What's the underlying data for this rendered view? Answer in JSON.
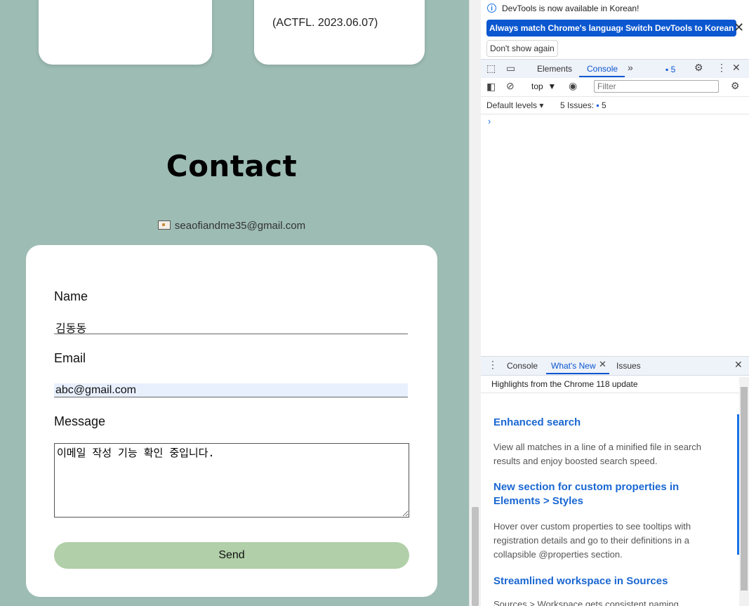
{
  "page": {
    "card_right_text": "(ACTFL. 2023.06.07)",
    "contact_title": "Contact",
    "contact_email": "seaofiandme35@gmail.com",
    "form": {
      "name_label": "Name",
      "name_value": "김동동",
      "email_label": "Email",
      "email_value": "abc@gmail.com",
      "message_label": "Message",
      "message_value": "이메일 작성 기능 확인 중입니다.",
      "send_label": "Send"
    }
  },
  "devtools": {
    "infobar": {
      "text": "DevTools is now available in Korean!",
      "match_language": "Always match Chrome's language",
      "switch_korean": "Switch DevTools to Korean",
      "dont_show": "Don't show again"
    },
    "tabs": {
      "elements": "Elements",
      "console": "Console",
      "issues_count": "5"
    },
    "console_toolbar": {
      "context": "top",
      "filter_placeholder": "Filter",
      "default_levels": "Default levels",
      "issues_label": "5 Issues:",
      "issues_count": "5"
    },
    "drawer": {
      "tab_console": "Console",
      "tab_whatsnew": "What's New",
      "tab_issues": "Issues",
      "highlights": "Highlights from the Chrome 118 update",
      "items": [
        {
          "title": "Enhanced search",
          "desc": "View all matches in a line of a minified file in search results and enjoy boosted search speed."
        },
        {
          "title": "New section for custom properties in Elements > Styles",
          "desc": "Hover over custom properties to see tooltips with registration details and go to their definitions in a collapsible @properties section."
        },
        {
          "title": "Streamlined workspace in Sources",
          "desc": "Sources > Workspace gets consistent naming"
        }
      ]
    }
  }
}
